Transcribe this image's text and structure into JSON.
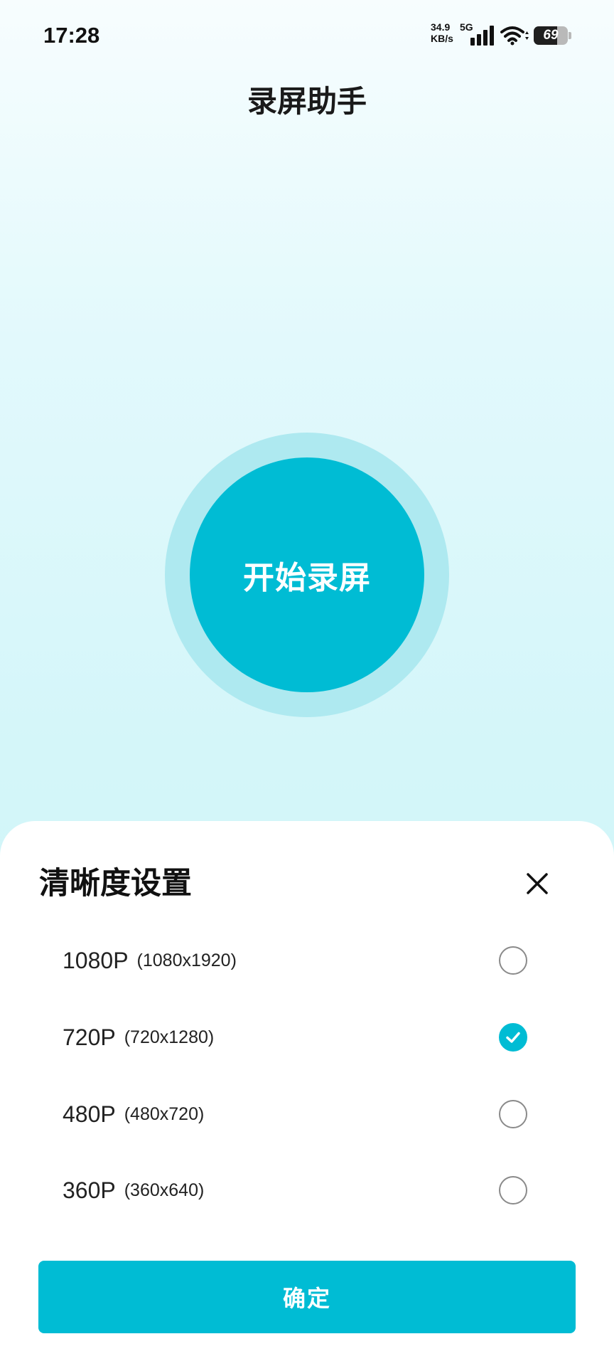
{
  "status_bar": {
    "time": "17:28",
    "net_speed_value": "34.9",
    "net_speed_unit": "KB/s",
    "network_type": "5G",
    "signal_icon": "signal-bars-icon",
    "wifi_icon": "wifi-icon",
    "battery_level": "69",
    "battery_fraction": 0.69
  },
  "header": {
    "title": "录屏助手"
  },
  "record_button": {
    "label": "开始录屏"
  },
  "resolution_sheet": {
    "title": "清晰度设置",
    "close_icon": "close-icon",
    "options": [
      {
        "name": "1080P",
        "size": "(1080x1920)",
        "selected": false
      },
      {
        "name": "720P",
        "size": "(720x1280)",
        "selected": true
      },
      {
        "name": "480P",
        "size": "(480x720)",
        "selected": false
      },
      {
        "name": "360P",
        "size": "(360x640)",
        "selected": false
      }
    ],
    "confirm_label": "确定"
  },
  "colors": {
    "accent": "#00bcd4",
    "ring": "#aee9f0",
    "bg_top": "#f7fdfe",
    "bg_bottom": "#c9f2f7"
  }
}
